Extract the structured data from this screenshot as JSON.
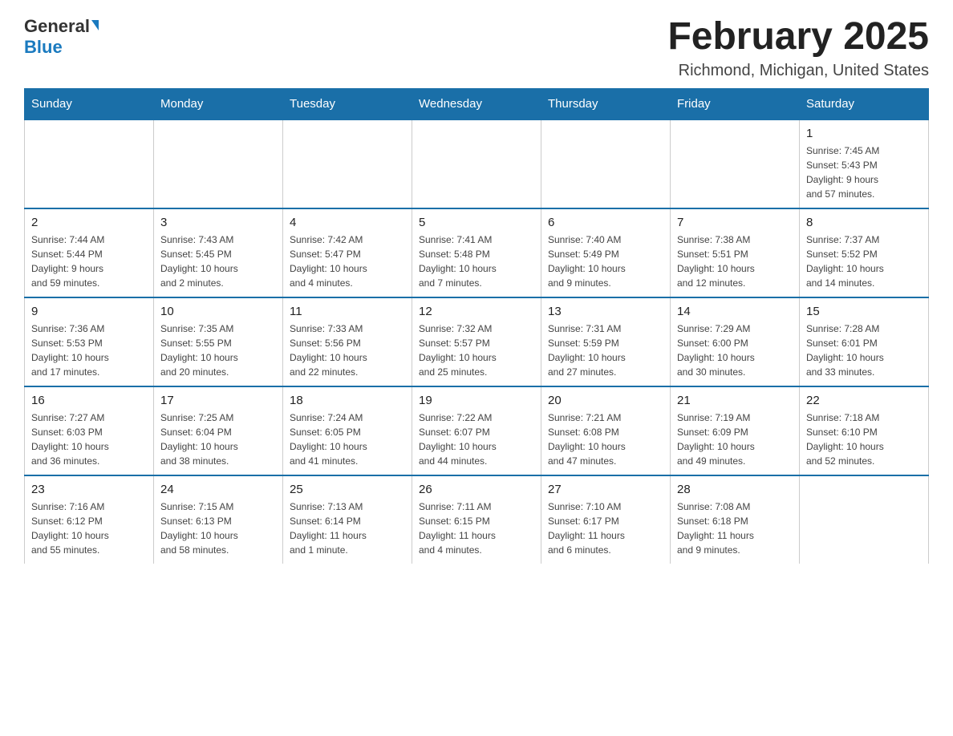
{
  "logo": {
    "general": "General",
    "blue": "Blue"
  },
  "title": "February 2025",
  "subtitle": "Richmond, Michigan, United States",
  "days_of_week": [
    "Sunday",
    "Monday",
    "Tuesday",
    "Wednesday",
    "Thursday",
    "Friday",
    "Saturday"
  ],
  "weeks": [
    [
      {
        "day": "",
        "info": ""
      },
      {
        "day": "",
        "info": ""
      },
      {
        "day": "",
        "info": ""
      },
      {
        "day": "",
        "info": ""
      },
      {
        "day": "",
        "info": ""
      },
      {
        "day": "",
        "info": ""
      },
      {
        "day": "1",
        "info": "Sunrise: 7:45 AM\nSunset: 5:43 PM\nDaylight: 9 hours\nand 57 minutes."
      }
    ],
    [
      {
        "day": "2",
        "info": "Sunrise: 7:44 AM\nSunset: 5:44 PM\nDaylight: 9 hours\nand 59 minutes."
      },
      {
        "day": "3",
        "info": "Sunrise: 7:43 AM\nSunset: 5:45 PM\nDaylight: 10 hours\nand 2 minutes."
      },
      {
        "day": "4",
        "info": "Sunrise: 7:42 AM\nSunset: 5:47 PM\nDaylight: 10 hours\nand 4 minutes."
      },
      {
        "day": "5",
        "info": "Sunrise: 7:41 AM\nSunset: 5:48 PM\nDaylight: 10 hours\nand 7 minutes."
      },
      {
        "day": "6",
        "info": "Sunrise: 7:40 AM\nSunset: 5:49 PM\nDaylight: 10 hours\nand 9 minutes."
      },
      {
        "day": "7",
        "info": "Sunrise: 7:38 AM\nSunset: 5:51 PM\nDaylight: 10 hours\nand 12 minutes."
      },
      {
        "day": "8",
        "info": "Sunrise: 7:37 AM\nSunset: 5:52 PM\nDaylight: 10 hours\nand 14 minutes."
      }
    ],
    [
      {
        "day": "9",
        "info": "Sunrise: 7:36 AM\nSunset: 5:53 PM\nDaylight: 10 hours\nand 17 minutes."
      },
      {
        "day": "10",
        "info": "Sunrise: 7:35 AM\nSunset: 5:55 PM\nDaylight: 10 hours\nand 20 minutes."
      },
      {
        "day": "11",
        "info": "Sunrise: 7:33 AM\nSunset: 5:56 PM\nDaylight: 10 hours\nand 22 minutes."
      },
      {
        "day": "12",
        "info": "Sunrise: 7:32 AM\nSunset: 5:57 PM\nDaylight: 10 hours\nand 25 minutes."
      },
      {
        "day": "13",
        "info": "Sunrise: 7:31 AM\nSunset: 5:59 PM\nDaylight: 10 hours\nand 27 minutes."
      },
      {
        "day": "14",
        "info": "Sunrise: 7:29 AM\nSunset: 6:00 PM\nDaylight: 10 hours\nand 30 minutes."
      },
      {
        "day": "15",
        "info": "Sunrise: 7:28 AM\nSunset: 6:01 PM\nDaylight: 10 hours\nand 33 minutes."
      }
    ],
    [
      {
        "day": "16",
        "info": "Sunrise: 7:27 AM\nSunset: 6:03 PM\nDaylight: 10 hours\nand 36 minutes."
      },
      {
        "day": "17",
        "info": "Sunrise: 7:25 AM\nSunset: 6:04 PM\nDaylight: 10 hours\nand 38 minutes."
      },
      {
        "day": "18",
        "info": "Sunrise: 7:24 AM\nSunset: 6:05 PM\nDaylight: 10 hours\nand 41 minutes."
      },
      {
        "day": "19",
        "info": "Sunrise: 7:22 AM\nSunset: 6:07 PM\nDaylight: 10 hours\nand 44 minutes."
      },
      {
        "day": "20",
        "info": "Sunrise: 7:21 AM\nSunset: 6:08 PM\nDaylight: 10 hours\nand 47 minutes."
      },
      {
        "day": "21",
        "info": "Sunrise: 7:19 AM\nSunset: 6:09 PM\nDaylight: 10 hours\nand 49 minutes."
      },
      {
        "day": "22",
        "info": "Sunrise: 7:18 AM\nSunset: 6:10 PM\nDaylight: 10 hours\nand 52 minutes."
      }
    ],
    [
      {
        "day": "23",
        "info": "Sunrise: 7:16 AM\nSunset: 6:12 PM\nDaylight: 10 hours\nand 55 minutes."
      },
      {
        "day": "24",
        "info": "Sunrise: 7:15 AM\nSunset: 6:13 PM\nDaylight: 10 hours\nand 58 minutes."
      },
      {
        "day": "25",
        "info": "Sunrise: 7:13 AM\nSunset: 6:14 PM\nDaylight: 11 hours\nand 1 minute."
      },
      {
        "day": "26",
        "info": "Sunrise: 7:11 AM\nSunset: 6:15 PM\nDaylight: 11 hours\nand 4 minutes."
      },
      {
        "day": "27",
        "info": "Sunrise: 7:10 AM\nSunset: 6:17 PM\nDaylight: 11 hours\nand 6 minutes."
      },
      {
        "day": "28",
        "info": "Sunrise: 7:08 AM\nSunset: 6:18 PM\nDaylight: 11 hours\nand 9 minutes."
      },
      {
        "day": "",
        "info": ""
      }
    ]
  ]
}
